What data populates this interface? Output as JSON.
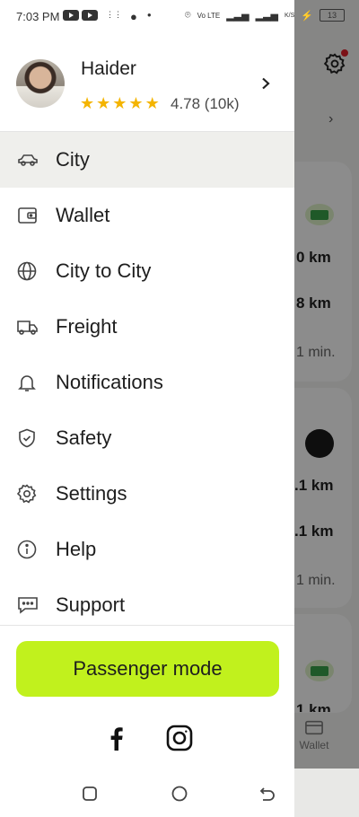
{
  "status_bar": {
    "time": "7:03 PM",
    "battery": "13"
  },
  "profile": {
    "name": "Haider",
    "rating": "4.78 (10k)",
    "stars": 5
  },
  "menu": [
    {
      "label": "City",
      "icon": "car-icon",
      "active": true
    },
    {
      "label": "Wallet",
      "icon": "wallet-icon"
    },
    {
      "label": "City to City",
      "icon": "globe-icon"
    },
    {
      "label": "Freight",
      "icon": "truck-icon"
    },
    {
      "label": "Notifications",
      "icon": "bell-icon"
    },
    {
      "label": "Safety",
      "icon": "shield-icon"
    },
    {
      "label": "Settings",
      "icon": "gear-icon"
    },
    {
      "label": "Help",
      "icon": "info-icon"
    },
    {
      "label": "Support",
      "icon": "chat-icon"
    }
  ],
  "passenger_button": "Passenger mode",
  "background": {
    "distances": [
      "0 km",
      "8 km",
      ".1 km",
      ".1 km",
      "1 km"
    ],
    "times": [
      "1 min.",
      "1 min."
    ],
    "wallet_label": "Wallet"
  },
  "colors": {
    "accent": "#c1f11d",
    "star": "#f4b400"
  }
}
